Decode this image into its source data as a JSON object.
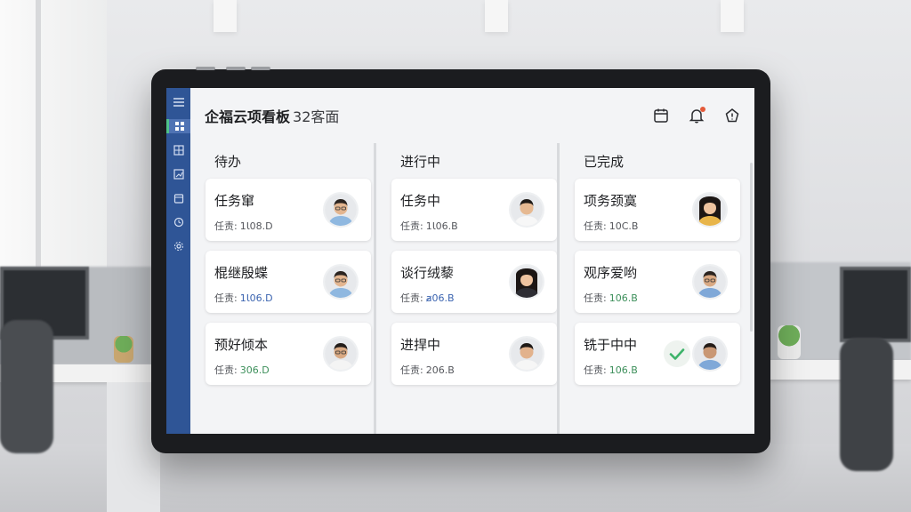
{
  "app": {
    "title": "企福云项看板",
    "subtitle": "32客面"
  },
  "columns": [
    {
      "title": "待办",
      "cards": [
        {
          "title": "任务窜",
          "meta_label": "任责:",
          "meta_value": "1Ɩ08.D",
          "meta_color": "#55575c",
          "avatar": "man-glasses"
        },
        {
          "title": "棍继殷蝶",
          "meta_label": "任责:",
          "meta_value": "1Ɩ06.D",
          "meta_color": "#3b64b0",
          "avatar": "man-glasses"
        },
        {
          "title": "预好倾本",
          "meta_label": "任责:",
          "meta_value": "306.D",
          "meta_color": "#3c8f5a",
          "avatar": "man-glasses"
        }
      ]
    },
    {
      "title": "进行中",
      "cards": [
        {
          "title": "任务中",
          "meta_label": "任责:",
          "meta_value": "1Ɩ06.B",
          "meta_color": "#55575c",
          "avatar": "man"
        },
        {
          "title": "谈行绒藜",
          "meta_label": "任责:",
          "meta_value": "ⱥ06.B",
          "meta_color": "#3b64b0",
          "avatar": "woman"
        },
        {
          "title": "进捍中",
          "meta_label": "任责:",
          "meta_value": "206.B",
          "meta_color": "#55575c",
          "avatar": "man"
        }
      ]
    },
    {
      "title": "已完成",
      "cards": [
        {
          "title": "项务颈寞",
          "meta_label": "任责:",
          "meta_value": "10C.B",
          "meta_color": "#55575c",
          "avatar": "woman"
        },
        {
          "title": "观序爱哟",
          "meta_label": "任责:",
          "meta_value": "106.B",
          "meta_color": "#3c8f5a",
          "avatar": "man-glasses"
        },
        {
          "title": "铣于中中",
          "meta_label": "任责:",
          "meta_value": "106.B",
          "meta_color": "#3c8f5a",
          "avatar": "man",
          "done": true
        }
      ]
    }
  ],
  "colors": {
    "sidebar": "#2f5596",
    "accent_green": "#4ec28a",
    "notification_dot": "#e45a3a"
  },
  "icons": {
    "sidebar": [
      "menu-icon",
      "dashboard-icon",
      "board-icon",
      "chart-icon",
      "calendar-icon",
      "clock-icon",
      "settings-icon"
    ],
    "topbar": [
      "calendar-icon",
      "bell-icon",
      "alert-icon"
    ]
  }
}
